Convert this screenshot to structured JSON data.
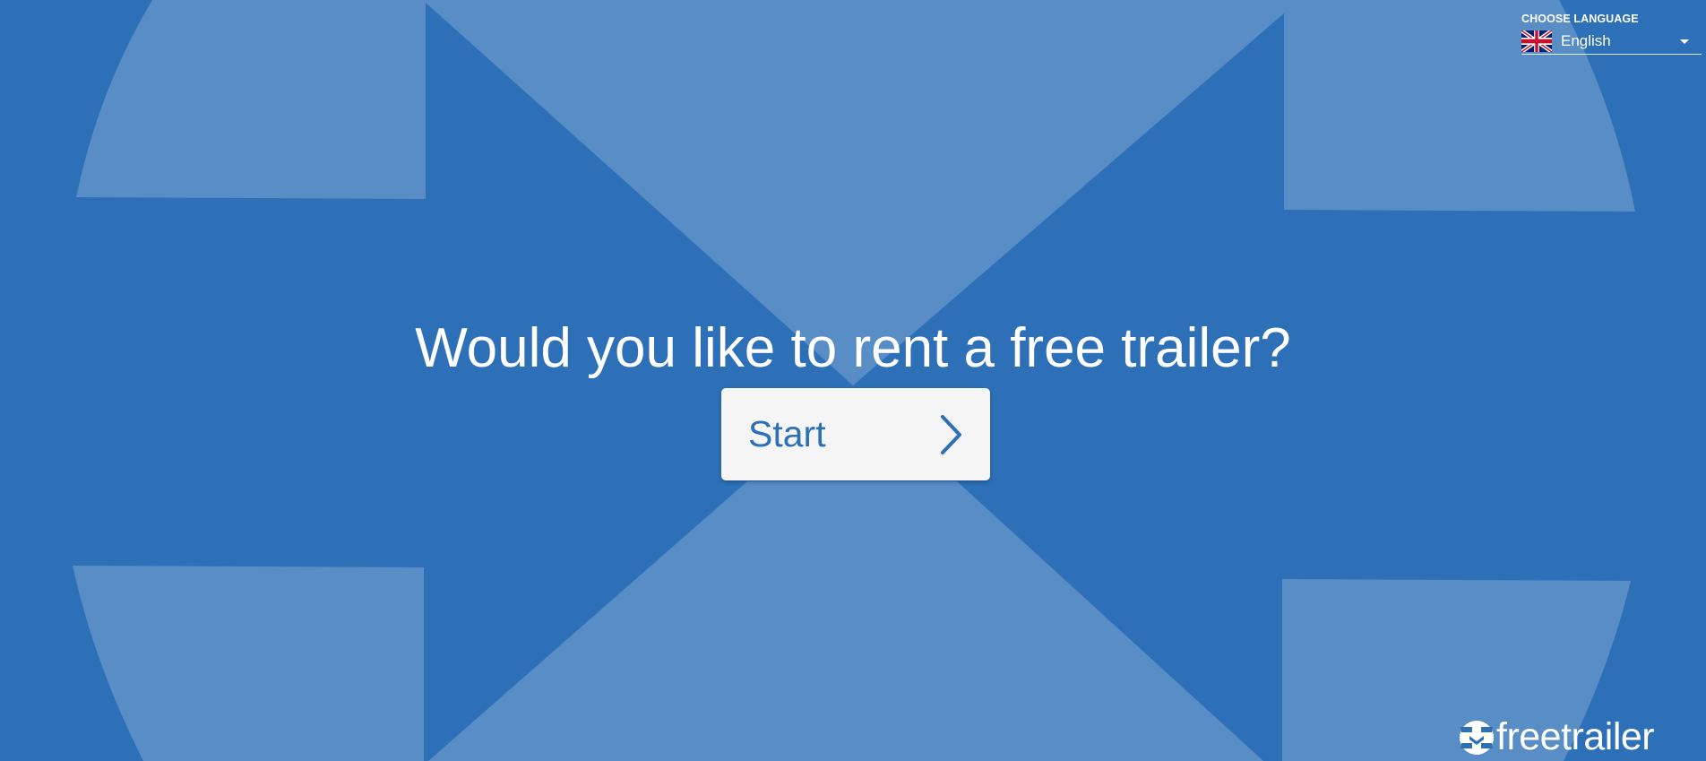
{
  "colors": {
    "background": "#2d70b8",
    "shapes": "#588dc6",
    "button_bg": "#f5f5f5",
    "button_text": "#2d70b8",
    "text": "#ffffff"
  },
  "language": {
    "label": "CHOOSE LANGUAGE",
    "selected": "English",
    "flag_icon": "uk-flag-icon"
  },
  "hero": {
    "headline": "Would you like to rent a free trailer?",
    "start_label": "Start"
  },
  "brand": {
    "name": "freetrailer"
  }
}
